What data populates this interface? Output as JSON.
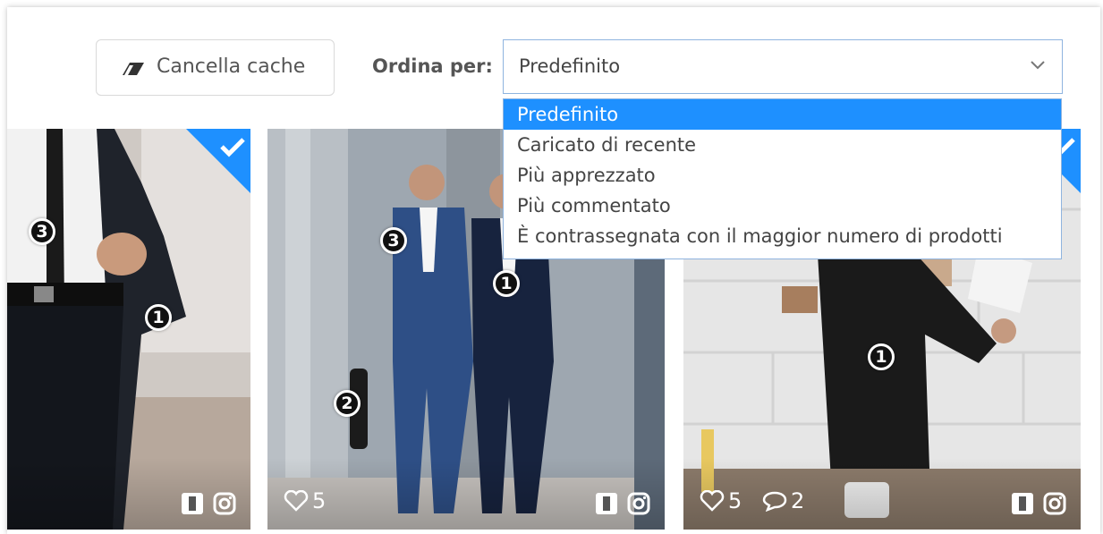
{
  "toolbar": {
    "clear_cache_label": "Cancella cache",
    "sort_label": "Ordina per:",
    "sort_selected": "Predefinito"
  },
  "sort_options": [
    "Predefinito",
    "Caricato di recente",
    "Più apprezzato",
    "Più commentato",
    "È contrassegnata con il maggior numero di prodotti"
  ],
  "tiles": [
    {
      "markers": [
        "3",
        "1"
      ],
      "selected": true
    },
    {
      "markers": [
        "3",
        "1",
        "2"
      ],
      "likes": "5",
      "selected": false
    },
    {
      "markers": [
        "1"
      ],
      "likes": "5",
      "comments": "2",
      "selected": true
    }
  ],
  "icons": {
    "eraser": "eraser-icon",
    "chevron": "chevron-down-icon",
    "check": "check-icon",
    "heart": "heart-icon",
    "comment": "comment-icon",
    "instagram": "instagram-icon",
    "product": "product-tag-icon"
  },
  "colors": {
    "accent": "#1e90ff",
    "select_border": "#8fb4df",
    "selected_check": "#1e90ff"
  }
}
